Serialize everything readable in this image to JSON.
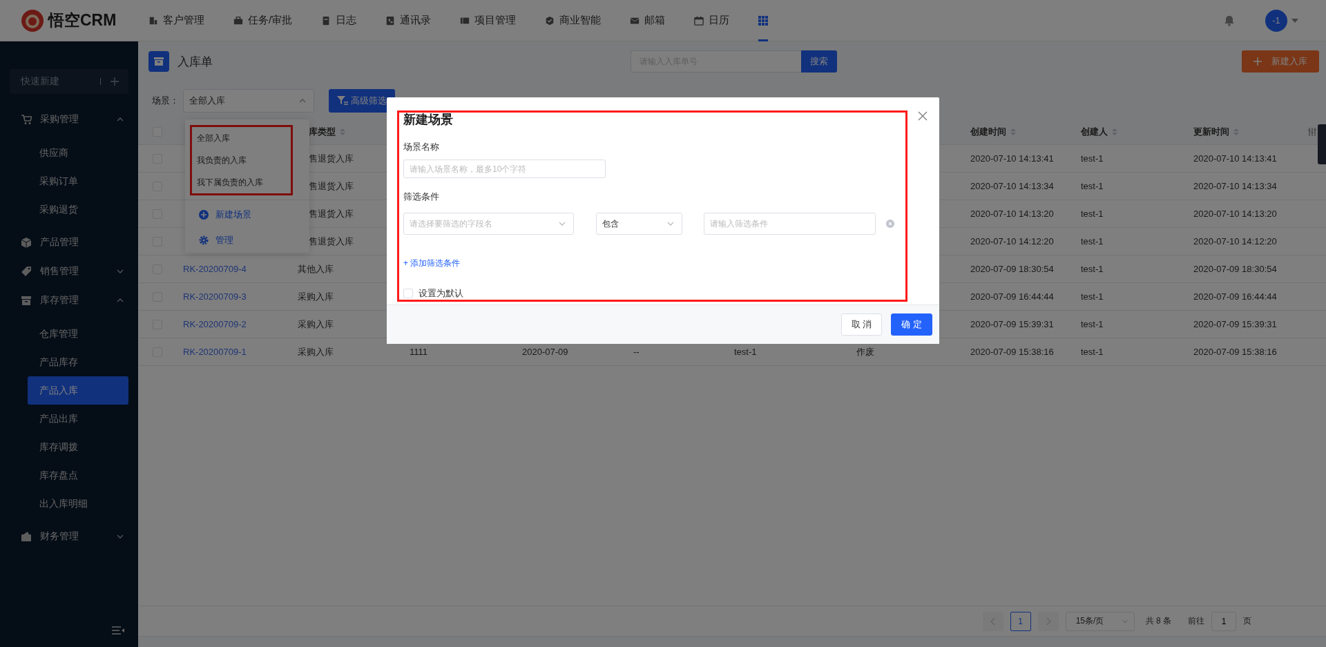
{
  "topbar": {
    "logo": "悟空CRM",
    "nav_items": [
      {
        "label": "客户管理",
        "selected": false
      },
      {
        "label": "任务/审批",
        "selected": false
      },
      {
        "label": "日志",
        "selected": false
      },
      {
        "label": "通讯录",
        "selected": false
      },
      {
        "label": "项目管理",
        "selected": false
      },
      {
        "label": "商业智能",
        "selected": false
      },
      {
        "label": "邮箱",
        "selected": false
      },
      {
        "label": "日历",
        "selected": false
      }
    ],
    "apps_menu": {
      "selected": true
    },
    "avatar": "-1"
  },
  "sidebar": {
    "quick_create": "快速新建",
    "items": [
      {
        "label": "采购管理",
        "expanded": true,
        "children": [
          {
            "label": "供应商",
            "selected": false
          },
          {
            "label": "采购订单",
            "selected": false
          },
          {
            "label": "采购退货",
            "selected": false
          }
        ]
      },
      {
        "label": "产品管理"
      },
      {
        "label": "销售管理",
        "expanded": false
      },
      {
        "label": "库存管理",
        "expanded": true,
        "children": [
          {
            "label": "仓库管理",
            "selected": false
          },
          {
            "label": "产品库存",
            "selected": false
          },
          {
            "label": "产品入库",
            "selected": true
          },
          {
            "label": "产品出库",
            "selected": false
          },
          {
            "label": "库存调拨",
            "selected": false
          },
          {
            "label": "库存盘点",
            "selected": false
          },
          {
            "label": "出入库明细",
            "selected": false
          }
        ]
      },
      {
        "label": "财务管理",
        "expanded": false
      }
    ]
  },
  "page": {
    "title": "入库单",
    "search": {
      "placeholder": "请输入入库单号",
      "button": "搜索"
    },
    "new_button": "新建入库",
    "scene_label": "场景：",
    "scene_select": {
      "value": "全部入库",
      "open": true
    },
    "advanced_filter": "高级筛选"
  },
  "scene_menu": {
    "options": [
      {
        "label": "全部入库"
      },
      {
        "label": "我负责的入库"
      },
      {
        "label": "我下属负责的入库"
      }
    ],
    "actions": [
      {
        "label": "新建场景",
        "kind": "add"
      },
      {
        "label": "管理",
        "kind": "manage"
      }
    ]
  },
  "table": {
    "select_all": {
      "checked": false
    },
    "header": {
      "type": "库类型",
      "created_time": "创建时间",
      "creator": "创建人",
      "updated_time": "更新时间"
    },
    "rows": [
      {
        "checked": false,
        "type": "售退货入库",
        "created_time": "2020-07-10 14:13:41",
        "creator": "test-1",
        "updated_time": "2020-07-10 14:13:41"
      },
      {
        "checked": false,
        "type": "售退货入库",
        "created_time": "2020-07-10 14:13:34",
        "creator": "test-1",
        "updated_time": "2020-07-10 14:13:34"
      },
      {
        "checked": false,
        "type": "售退货入库",
        "created_time": "2020-07-10 14:13:20",
        "creator": "test-1",
        "updated_time": "2020-07-10 14:13:20"
      },
      {
        "checked": false,
        "type": "售退货入库",
        "created_time": "2020-07-10 14:12:20",
        "creator": "test-1",
        "updated_time": "2020-07-10 14:12:20"
      },
      {
        "checked": false,
        "number": "RK-20200709-4",
        "type": "其他入库",
        "created_time": "2020-07-09 18:30:54",
        "creator": "test-1",
        "updated_time": "2020-07-09 18:30:54"
      },
      {
        "checked": false,
        "number": "RK-20200709-3",
        "type": "采购入库",
        "created_time": "2020-07-09 16:44:44",
        "creator": "test-1",
        "updated_time": "2020-07-09 16:44:44"
      },
      {
        "checked": false,
        "number": "RK-20200709-2",
        "type": "采购入库",
        "created_time": "2020-07-09 15:39:31",
        "creator": "test-1",
        "updated_time": "2020-07-09 15:39:31"
      },
      {
        "checked": false,
        "number": "RK-20200709-1",
        "type": "采购入库",
        "column_3": "1111",
        "column_4": "2020-07-09",
        "column_5": "--",
        "column_6": "test-1",
        "column_7": "作废",
        "created_time": "2020-07-09 15:38:16",
        "creator": "test-1",
        "updated_time": "2020-07-09 15:38:16"
      }
    ]
  },
  "pagination": {
    "page": "1",
    "page_size": "15条/页",
    "total": "共 8 条",
    "goto_label": "前往",
    "goto_value": "1",
    "goto_suffix": "页"
  },
  "modal": {
    "title": "新建场景",
    "name_label": "场景名称",
    "name_placeholder": "请输入场景名称，最多10个字符",
    "condition_label": "筛选条件",
    "field_placeholder": "请选择要筛选的字段名",
    "operator": "包含",
    "value_placeholder": "请输入筛选条件",
    "add_condition": "+ 添加筛选条件",
    "default_checkbox": {
      "label": "设置为默认",
      "checked": false
    },
    "buttons": [
      {
        "label": "取 消",
        "kind": "secondary"
      },
      {
        "label": "确 定",
        "kind": "primary"
      }
    ]
  }
}
